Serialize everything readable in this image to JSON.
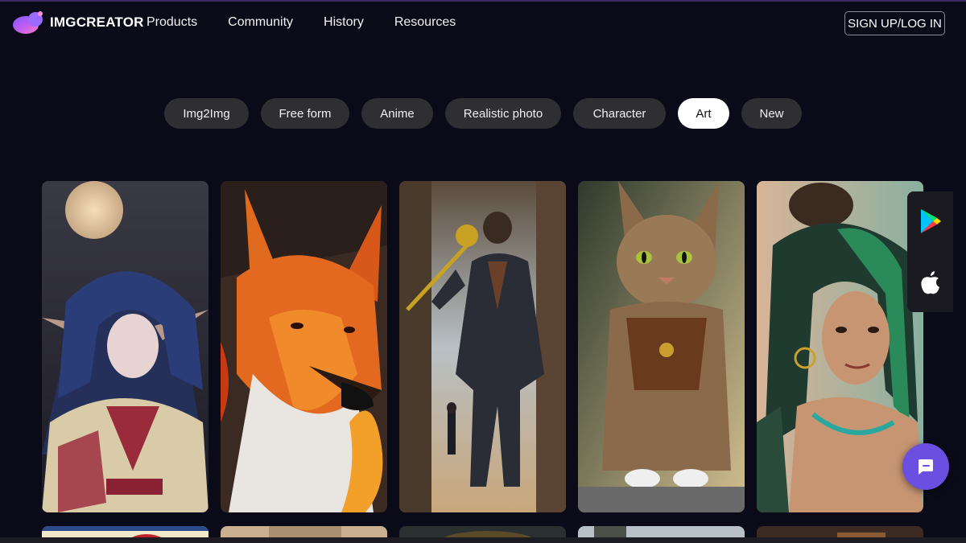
{
  "header": {
    "logo_text": "IMGCREATOR",
    "nav": [
      "Products",
      "Community",
      "History",
      "Resources"
    ],
    "signup_label": "SIGN UP/LOG IN"
  },
  "categories": {
    "items": [
      "Img2Img",
      "Free form",
      "Anime",
      "Realistic photo",
      "Character",
      "Art",
      "New"
    ],
    "active": "Art"
  },
  "gallery": {
    "row1": [
      "elf-girl-moon",
      "fire-fox",
      "chimpanzee-suit",
      "tabby-cat-armor",
      "green-hair-woman"
    ]
  },
  "side_panel": {
    "icons": [
      "google-play-icon",
      "apple-icon"
    ]
  },
  "chat": {
    "icon": "chat-icon"
  },
  "colors": {
    "background": "#0b0a18",
    "pill": "#2e2e33",
    "pill_active": "#ffffff",
    "chat": "#6a4fe0"
  }
}
